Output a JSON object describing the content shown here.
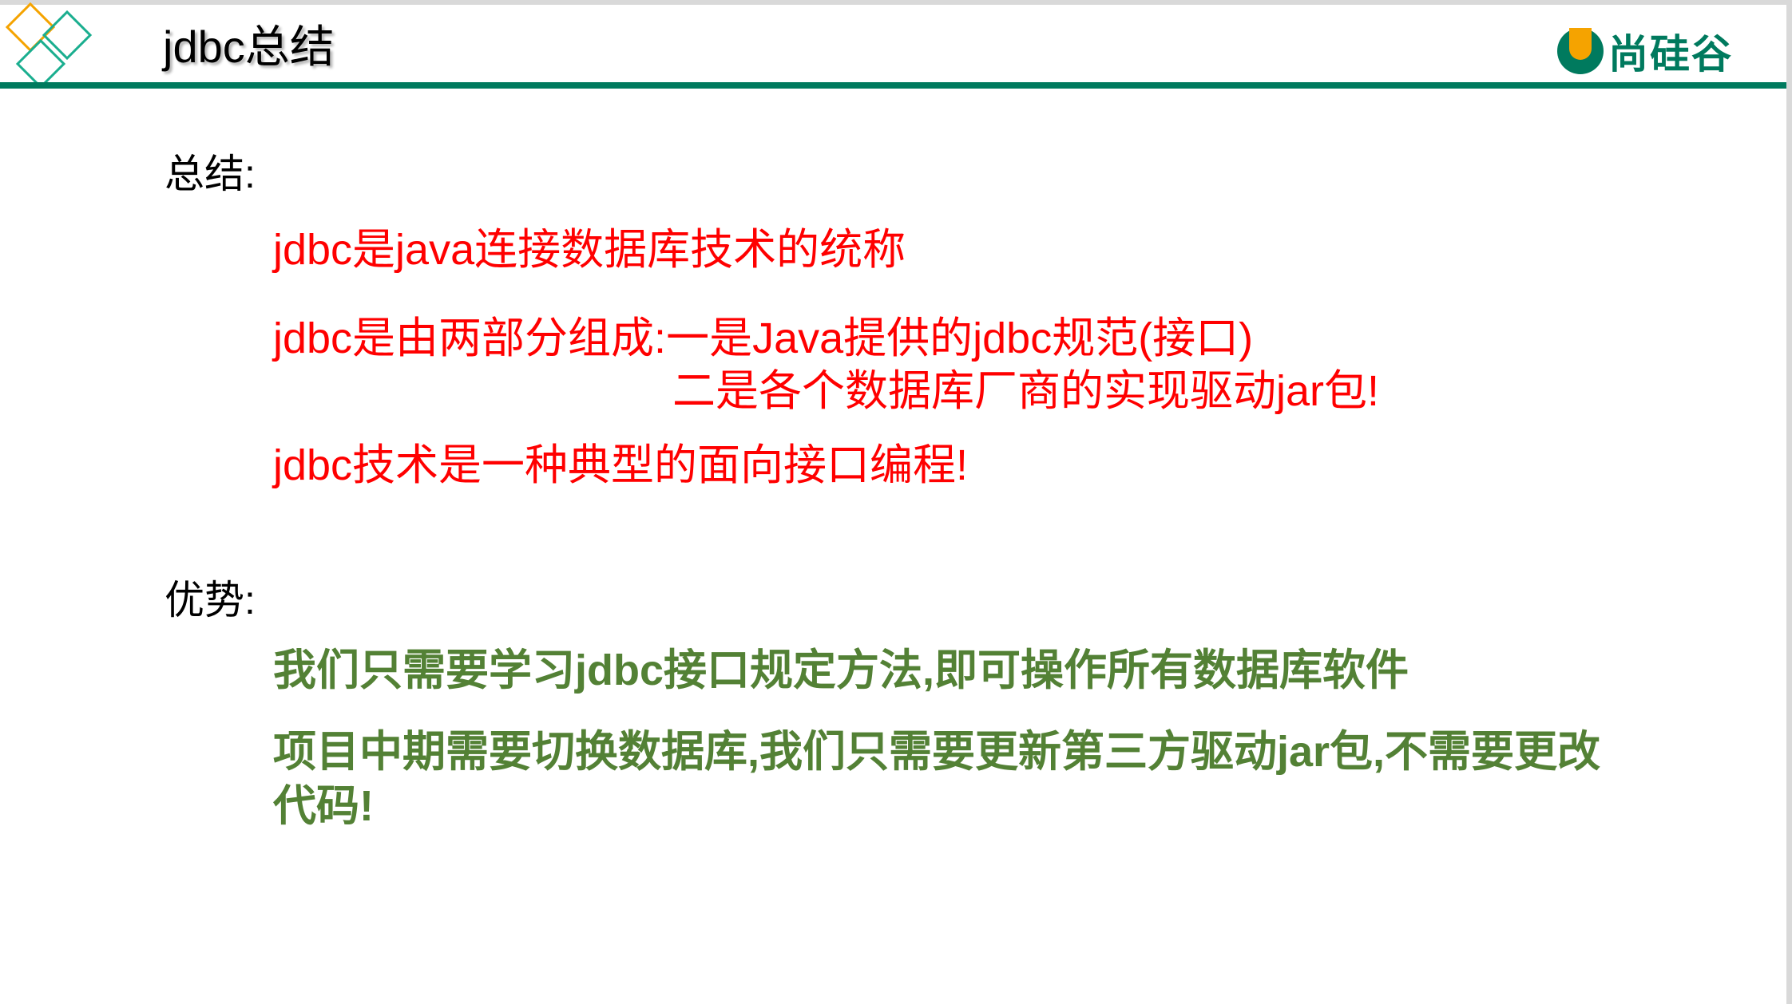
{
  "header": {
    "title": "jdbc总结",
    "brand": "尚硅谷"
  },
  "summary": {
    "heading": "总结:",
    "lines": [
      "jdbc是java连接数据库技术的统称",
      "jdbc是由两部分组成:一是Java提供的jdbc规范(接口)",
      "二是各个数据库厂商的实现驱动jar包!",
      "jdbc技术是一种典型的面向接口编程!"
    ]
  },
  "advantages": {
    "heading": "优势:",
    "lines": [
      "我们只需要学习jdbc接口规定方法,即可操作所有数据库软件",
      "项目中期需要切换数据库,我们只需要更新第三方驱动jar包,不需要更改代码!"
    ]
  },
  "colors": {
    "accent": "#007a5e",
    "summary_text": "#ff0000",
    "advantage_text": "#538135",
    "logo_orange": "#f5a300"
  }
}
